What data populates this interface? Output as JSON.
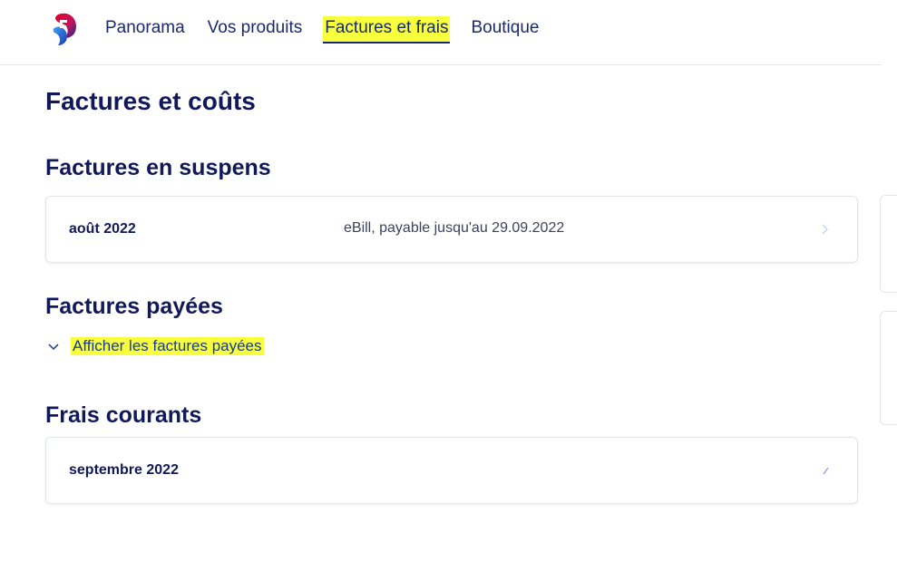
{
  "nav": {
    "items": [
      {
        "label": "Panorama",
        "active": false
      },
      {
        "label": "Vos produits",
        "active": false
      },
      {
        "label": "Factures et frais",
        "active": true
      },
      {
        "label": "Boutique",
        "active": false
      }
    ]
  },
  "page": {
    "title": "Factures et coûts"
  },
  "pending": {
    "title": "Factures en suspens",
    "invoice": {
      "date": "août 2022",
      "info": "eBill, payable jusqu'au 29.09.2022"
    }
  },
  "paid": {
    "title": "Factures payées",
    "toggle_label": "Afficher les factures payées"
  },
  "current": {
    "title": "Frais courants",
    "item": {
      "date": "septembre 2022"
    }
  },
  "colors": {
    "brand_red": "#e4002b",
    "brand_blue": "#1781e3",
    "text_dark": "#11195a",
    "highlight": "#f8ff3c"
  },
  "icons": [
    "swisscom-logo-icon",
    "chevron-right-icon",
    "chevron-down-icon"
  ]
}
